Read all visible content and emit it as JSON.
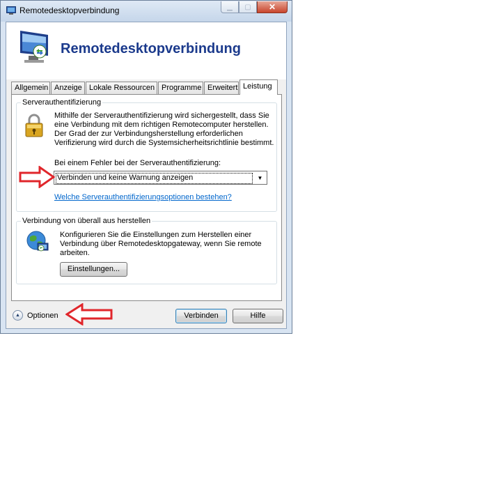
{
  "window": {
    "title": "Remotedesktopverbindung",
    "banner_title": "Remotedesktopverbindung"
  },
  "tabs": [
    {
      "label": "Allgemein",
      "active": false
    },
    {
      "label": "Anzeige",
      "active": false
    },
    {
      "label": "Lokale Ressourcen",
      "active": false
    },
    {
      "label": "Programme",
      "active": false
    },
    {
      "label": "Erweitert",
      "active": false
    },
    {
      "label": "Leistung",
      "active": true
    }
  ],
  "server_auth": {
    "group_label": "Serverauthentifizierung",
    "description_lines": [
      "Mithilfe der Serverauthentifizierung wird sichergestellt, dass Sie",
      "eine Verbindung mit dem richtigen Remotecomputer herstellen.",
      "Der Grad der zur Verbindungsherstellung erforderlichen",
      "Verifizierung wird durch die Systemsicherheitsrichtlinie bestimmt."
    ],
    "dropdown_label": "Bei einem Fehler bei der Serverauthentifizierung:",
    "dropdown_value": "Verbinden und keine Warnung anzeigen",
    "help_link": "Welche Serverauthentifizierungsoptionen bestehen?"
  },
  "gateway": {
    "group_label": "Verbindung von überall aus herstellen",
    "description_lines": [
      "Konfigurieren Sie die Einstellungen zum Herstellen einer",
      "Verbindung über Remotedesktopgateway, wenn Sie remote",
      "arbeiten."
    ],
    "settings_button": "Einstellungen..."
  },
  "footer": {
    "options_label": "Optionen",
    "connect_button": "Verbinden",
    "help_button": "Hilfe"
  },
  "colors": {
    "title_blue": "#1b3a8c",
    "annotation_red": "#e0262b",
    "link_blue": "#0066cc"
  },
  "icons": {
    "title": "remote-desktop-icon",
    "banner": "monitor-icon",
    "server_auth": "padlock-icon",
    "gateway": "globe-computer-icon",
    "options": "chevron-up-icon"
  }
}
